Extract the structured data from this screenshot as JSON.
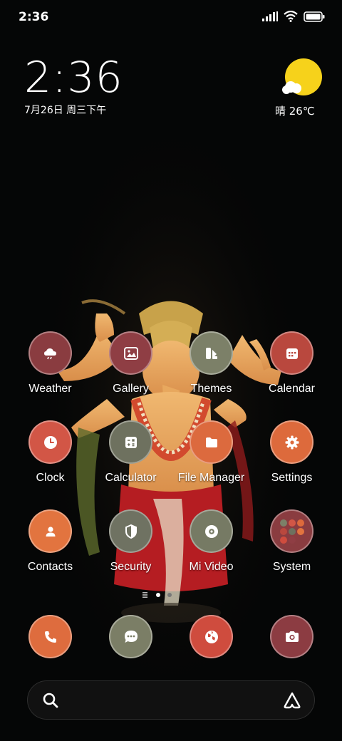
{
  "status_bar": {
    "time": "2:36"
  },
  "clock_widget": {
    "time": "2:36",
    "date": "7月26日 周三下午"
  },
  "weather_widget": {
    "text": "晴 26℃",
    "icon": "sunny-icon"
  },
  "apps": [
    {
      "label": "Weather",
      "icon": "cloud-rain-icon",
      "color": "#8a3c40"
    },
    {
      "label": "Gallery",
      "icon": "image-icon",
      "color": "#8f3e44"
    },
    {
      "label": "Themes",
      "icon": "themes-icon",
      "color": "#7c8068"
    },
    {
      "label": "Calendar",
      "icon": "calendar-icon",
      "color": "#b9483e"
    },
    {
      "label": "Clock",
      "icon": "clock-icon",
      "color": "#d25646"
    },
    {
      "label": "Calculator",
      "icon": "calculator-icon",
      "color": "#6e715f"
    },
    {
      "label": "File Manager",
      "icon": "folder-icon",
      "color": "#dc6a3e"
    },
    {
      "label": "Settings",
      "icon": "gear-icon",
      "color": "#dd6a3c"
    },
    {
      "label": "Contacts",
      "icon": "person-icon",
      "color": "#e2743f"
    },
    {
      "label": "Security",
      "icon": "shield-icon",
      "color": "#6f7262"
    },
    {
      "label": "Mi Video",
      "icon": "video-icon",
      "color": "#767a64"
    },
    {
      "label": "System",
      "icon": "folder-grid-icon",
      "color": "#8a3c40"
    }
  ],
  "dock": [
    {
      "icon": "phone-icon",
      "color": "#de6c3e"
    },
    {
      "icon": "message-icon",
      "color": "#7b7e66"
    },
    {
      "icon": "browser-icon",
      "color": "#cf4c3e"
    },
    {
      "icon": "camera-icon",
      "color": "#8c3c42"
    }
  ],
  "colors": {
    "background": "#050606",
    "sun": "#f6d21b"
  }
}
